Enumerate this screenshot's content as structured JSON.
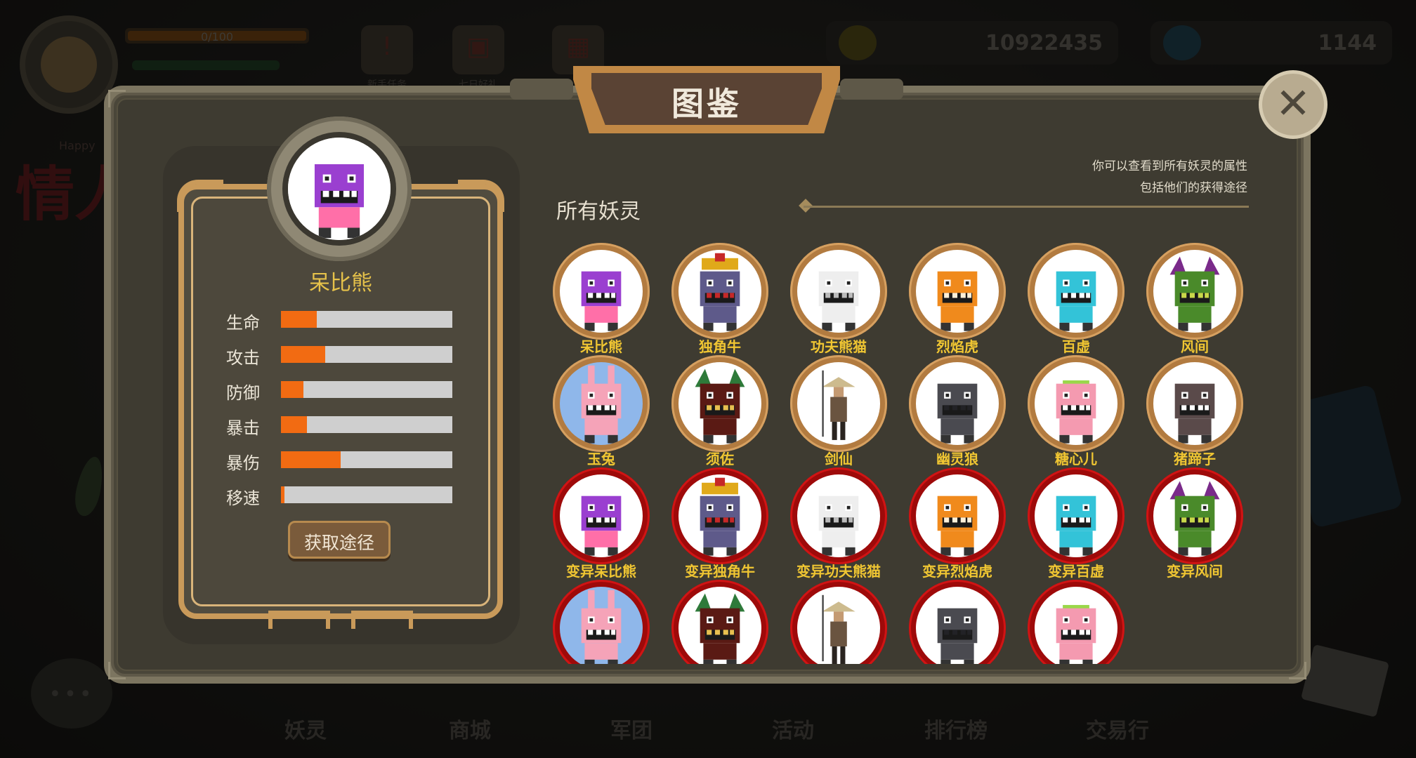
{
  "hud": {
    "exp_text": "0/100",
    "exp_fraction": 0.0,
    "gold": "10922435",
    "diamond": "1144",
    "buttons": [
      {
        "icon": "alert-icon",
        "glyph": "!",
        "label": "新手任务"
      },
      {
        "icon": "gift-icon",
        "glyph": "▣",
        "label": "七日好礼"
      },
      {
        "icon": "calendar-icon",
        "glyph": "▦",
        "label": ""
      }
    ],
    "banner_text": "情人",
    "banner_small": "Happy",
    "bottom_tabs": [
      "妖灵",
      "商城",
      "军团",
      "活动",
      "排行榜",
      "交易行"
    ]
  },
  "dialog": {
    "title": "图鉴",
    "close_glyph": "✕",
    "hint_lines": [
      "你可以查看到所有妖灵的属性",
      "包括他们的获得途径"
    ],
    "section_title": "所有妖灵"
  },
  "selected": {
    "name": "呆比熊",
    "obtain_label": "获取途径",
    "stats": [
      {
        "label": "生命",
        "value": 0.21
      },
      {
        "label": "攻击",
        "value": 0.26
      },
      {
        "label": "防御",
        "value": 0.13
      },
      {
        "label": "暴击",
        "value": 0.15
      },
      {
        "label": "暴伤",
        "value": 0.35
      },
      {
        "label": "移速",
        "value": 0.02
      }
    ]
  },
  "monsters": [
    {
      "name": "呆比熊",
      "variant": "normal",
      "icon": "bear-monster-icon",
      "palette": [
        "#9a3fd0",
        "#ff6fa8",
        "#ffffff"
      ]
    },
    {
      "name": "独角牛",
      "variant": "normal",
      "icon": "bull-monster-icon",
      "palette": [
        "#5e5a8a",
        "#e0a91a",
        "#c62828"
      ]
    },
    {
      "name": "功夫熊猫",
      "variant": "normal",
      "icon": "panda-monster-icon",
      "palette": [
        "#eeeeee",
        "#222222",
        "#bbbbbb"
      ]
    },
    {
      "name": "烈焰虎",
      "variant": "normal",
      "icon": "tiger-monster-icon",
      "palette": [
        "#f08a1c",
        "#3a2a1a",
        "#fff0d8"
      ]
    },
    {
      "name": "百虚",
      "variant": "normal",
      "icon": "blue-beast-icon",
      "palette": [
        "#33c3d8",
        "#1a6e8a",
        "#ffffff"
      ]
    },
    {
      "name": "风间",
      "variant": "normal",
      "icon": "green-dragon-icon",
      "palette": [
        "#4a8a2a",
        "#7a2a8a",
        "#c9d84a"
      ]
    },
    {
      "name": "玉兔",
      "variant": "normal",
      "icon": "rabbit-monster-icon",
      "palette": [
        "#f5a3b8",
        "#8fb7ea",
        "#ffffff"
      ]
    },
    {
      "name": "须佐",
      "variant": "normal",
      "icon": "demon-monster-icon",
      "palette": [
        "#5a1a14",
        "#2e7a3a",
        "#e8c050"
      ]
    },
    {
      "name": "剑仙",
      "variant": "normal",
      "icon": "swordsman-icon",
      "palette": [
        "#ffffff",
        "#6a5440",
        "#2a2420"
      ]
    },
    {
      "name": "幽灵狼",
      "variant": "normal",
      "icon": "ghost-wolf-icon",
      "palette": [
        "#4a4a50",
        "#9ad84a",
        "#222226"
      ]
    },
    {
      "name": "糖心儿",
      "variant": "normal",
      "icon": "pig-monster-icon",
      "palette": [
        "#f49ab0",
        "#9ad84a",
        "#ffffff"
      ]
    },
    {
      "name": "猪蹄子",
      "variant": "normal",
      "icon": "boar-monster-icon",
      "palette": [
        "#5a4a4a",
        "#d84a4a",
        "#ffffff"
      ]
    },
    {
      "name": "变异呆比熊",
      "variant": "mutant",
      "icon": "bear-monster-icon",
      "palette": [
        "#9a3fd0",
        "#ff6fa8",
        "#ffffff"
      ]
    },
    {
      "name": "变异独角牛",
      "variant": "mutant",
      "icon": "bull-monster-icon",
      "palette": [
        "#5e5a8a",
        "#e0a91a",
        "#c62828"
      ]
    },
    {
      "name": "变异功夫熊猫",
      "variant": "mutant",
      "icon": "panda-monster-icon",
      "palette": [
        "#eeeeee",
        "#222222",
        "#bbbbbb"
      ]
    },
    {
      "name": "变异烈焰虎",
      "variant": "mutant",
      "icon": "tiger-monster-icon",
      "palette": [
        "#f08a1c",
        "#3a2a1a",
        "#fff0d8"
      ]
    },
    {
      "name": "变异百虚",
      "variant": "mutant",
      "icon": "blue-beast-icon",
      "palette": [
        "#33c3d8",
        "#1a6e8a",
        "#ffffff"
      ]
    },
    {
      "name": "变异风间",
      "variant": "mutant",
      "icon": "green-dragon-icon",
      "palette": [
        "#4a8a2a",
        "#7a2a8a",
        "#c9d84a"
      ]
    },
    {
      "name": "",
      "variant": "mutant",
      "icon": "rabbit-monster-icon",
      "palette": [
        "#f5a3b8",
        "#8fb7ea",
        "#ffffff"
      ]
    },
    {
      "name": "",
      "variant": "mutant",
      "icon": "demon-monster-icon",
      "palette": [
        "#5a1a14",
        "#2e7a3a",
        "#e8c050"
      ]
    },
    {
      "name": "",
      "variant": "mutant",
      "icon": "swordsman-icon",
      "palette": [
        "#ffffff",
        "#6a5440",
        "#2a2420"
      ]
    },
    {
      "name": "",
      "variant": "mutant",
      "icon": "ghost-wolf-icon",
      "palette": [
        "#4a4a50",
        "#9ad84a",
        "#222226"
      ]
    },
    {
      "name": "",
      "variant": "mutant",
      "icon": "pig-monster-icon",
      "palette": [
        "#f49ab0",
        "#9ad84a",
        "#ffffff"
      ]
    }
  ],
  "colors": {
    "accent_orange": "#f26b12",
    "name_gold": "#f0c632",
    "mutant_ring": "#9e0a0a",
    "normal_ring": "#b27b40"
  }
}
